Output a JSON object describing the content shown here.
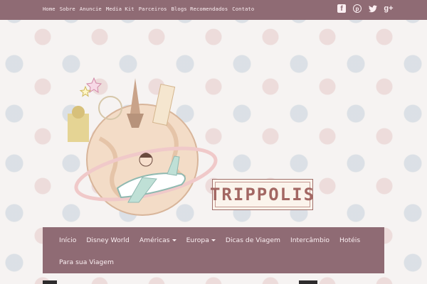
{
  "topnav": {
    "items": [
      "Home",
      "Sobre",
      "Anuncie",
      "Media Kit",
      "Parceiros",
      "Blogs Recomendados",
      "Contato"
    ]
  },
  "social": {
    "facebook": "f",
    "pinterest": "p",
    "twitter": "🐦",
    "googleplus": "g+"
  },
  "logo": {
    "text": "TRIPPOLIS"
  },
  "mainnav": {
    "items": [
      {
        "label": "Início",
        "dropdown": false
      },
      {
        "label": "Disney World",
        "dropdown": false
      },
      {
        "label": "Américas",
        "dropdown": true
      },
      {
        "label": "Europa",
        "dropdown": true
      },
      {
        "label": "Dicas de Viagem",
        "dropdown": false
      },
      {
        "label": "Intercâmbio",
        "dropdown": false
      },
      {
        "label": "Hotéis",
        "dropdown": false
      },
      {
        "label": "Para sua Viagem",
        "dropdown": false
      }
    ]
  },
  "colors": {
    "nav_bg": "#8f6b74",
    "nav_text": "#fbeff2",
    "logo_text": "#a36763",
    "page_bg": "#f6f3f2"
  }
}
